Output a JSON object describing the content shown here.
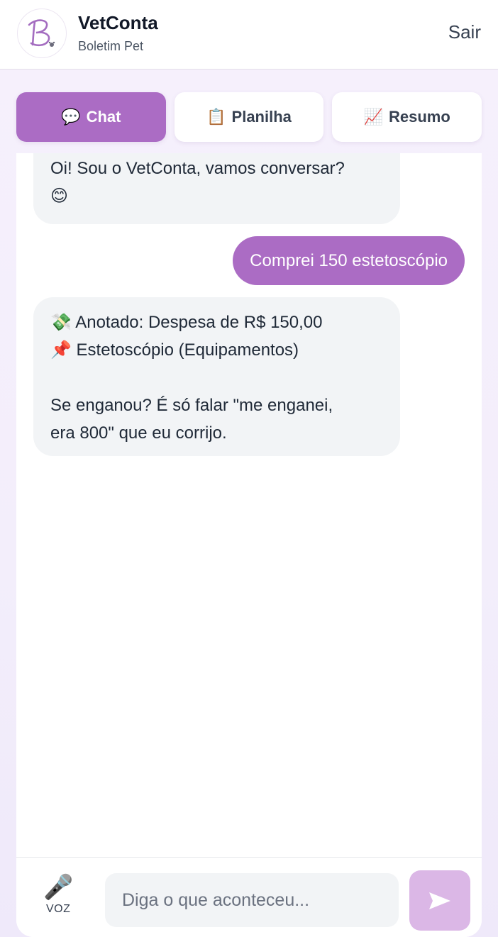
{
  "header": {
    "brand_title": "VetConta",
    "brand_subtitle": "Boletim Pet",
    "logout_label": "Sair",
    "logo_letter": "B"
  },
  "tabs": [
    {
      "icon": "💬",
      "label": "Chat",
      "active": true
    },
    {
      "icon": "📋",
      "label": "Planilha",
      "active": false
    },
    {
      "icon": "📈",
      "label": "Resumo",
      "active": false
    }
  ],
  "messages": [
    {
      "from": "bot",
      "lines": [
        "Oi! Sou o VetConta, vamos conversar?",
        "😊"
      ]
    },
    {
      "from": "user",
      "text": "Comprei 150 estetoscópio"
    },
    {
      "from": "bot",
      "lines": [
        "💸 Anotado: Despesa de R$ 150,00",
        "📌 Estetoscópio (Equipamentos)",
        "",
        "Se enganou? É só falar \"me enganei,",
        "era 800\" que eu corrijo."
      ]
    }
  ],
  "composer": {
    "voice_icon": "🎤",
    "voice_label": "VOZ",
    "placeholder": "Diga o que aconteceu...",
    "send_icon": "send-arrow-icon"
  },
  "colors": {
    "accent": "#ab6cc4",
    "send_disabled": "#dbb7e6",
    "bot_bubble": "#f2f4f6"
  }
}
